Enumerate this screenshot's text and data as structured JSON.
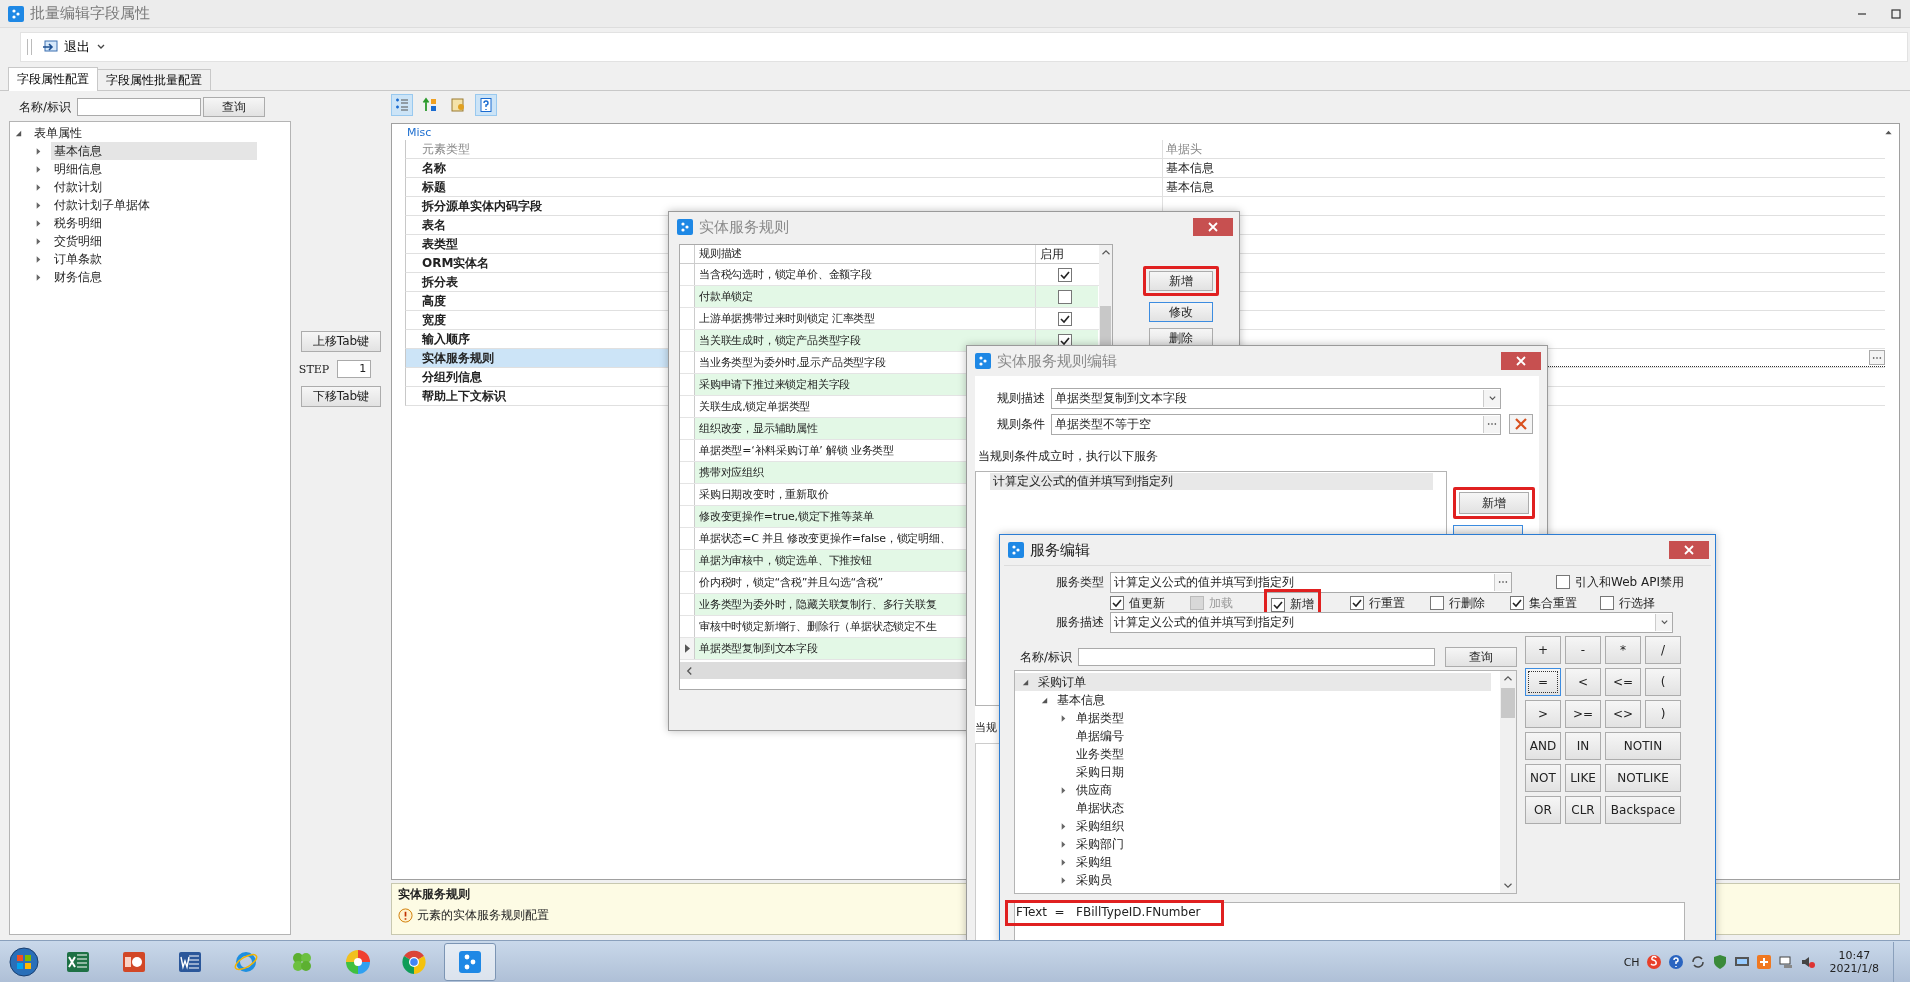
{
  "window": {
    "title": "批量编辑字段属性"
  },
  "toolbar": {
    "exit_label": "退出"
  },
  "tabs": [
    {
      "label": "字段属性配置",
      "selected": true
    },
    {
      "label": "字段属性批量配置",
      "selected": false
    }
  ],
  "left_search": {
    "label": "名称/标识",
    "button": "查询"
  },
  "field_tree": [
    {
      "label": "表单属性",
      "expanded": true,
      "selected": false,
      "children": [
        {
          "label": "基本信息",
          "expanded": false,
          "selected": true
        },
        {
          "label": "明细信息",
          "expanded": false,
          "selected": false
        },
        {
          "label": "付款计划",
          "expanded": false,
          "selected": false
        },
        {
          "label": "付款计划子单据体",
          "expanded": false,
          "selected": false
        },
        {
          "label": "税务明细",
          "expanded": false,
          "selected": false
        },
        {
          "label": "交货明细",
          "expanded": false,
          "selected": false
        },
        {
          "label": "订单条款",
          "expanded": false,
          "selected": false
        },
        {
          "label": "财务信息",
          "expanded": false,
          "selected": false
        }
      ]
    }
  ],
  "tab_order": {
    "up_button": "上移Tab键",
    "step_label": "STEP",
    "step_value": "1",
    "down_button": "下移Tab键"
  },
  "property_grid": {
    "tools": [
      {
        "selected": true
      },
      {
        "selected": false
      },
      {
        "selected": false
      },
      {
        "selected": true
      }
    ],
    "category": "Misc",
    "expanded": true,
    "rows": [
      {
        "name": "元素类型",
        "value": "单据头",
        "readonly": true,
        "selected": false
      },
      {
        "name": "名称",
        "value": "基本信息",
        "readonly": false,
        "selected": false
      },
      {
        "name": "标题",
        "value": "基本信息",
        "readonly": false,
        "selected": false
      },
      {
        "name": "拆分源单实体内码字段",
        "readonly": false,
        "selected": false
      },
      {
        "name": "表名",
        "readonly": false,
        "selected": false
      },
      {
        "name": "表类型",
        "readonly": false,
        "selected": false
      },
      {
        "name": "ORM实体名",
        "readonly": false,
        "selected": false
      },
      {
        "name": "拆分表",
        "readonly": false,
        "selected": false
      },
      {
        "name": "高度",
        "readonly": false,
        "selected": false
      },
      {
        "name": "宽度",
        "readonly": false,
        "selected": false
      },
      {
        "name": "输入顺序",
        "readonly": false,
        "selected": false
      },
      {
        "name": "实体服务规则",
        "readonly": false,
        "selected": true
      },
      {
        "name": "分组列信息",
        "readonly": false,
        "selected": false
      },
      {
        "name": "帮助上下文标识",
        "readonly": false,
        "selected": false
      }
    ]
  },
  "help": {
    "title": "实体服务规则",
    "text": "元素的实体服务规则配置"
  },
  "rules_dialog": {
    "title": "实体服务规则",
    "columns": [
      "规则描述",
      "启用"
    ],
    "rows": [
      {
        "text": "当含税勾选时，锁定单价、金额字段",
        "enabled": true,
        "selected": false
      },
      {
        "text": "付款单锁定",
        "enabled": false,
        "selected": false
      },
      {
        "text": "上游单据携带过来时则锁定 汇率类型",
        "enabled": true,
        "selected": false
      },
      {
        "text": "当关联生成时，锁定产品类型字段",
        "enabled": true,
        "selected": false
      },
      {
        "text": "当业务类型为委外时,显示产品类型字段",
        "selected": false
      },
      {
        "text": "采购申请下推过来锁定相关字段",
        "selected": false
      },
      {
        "text": "关联生成,锁定单据类型",
        "selected": false
      },
      {
        "text": "组织改变，显示辅助属性",
        "selected": false
      },
      {
        "text": "单据类型=‘补料采购订单’ 解锁 业务类型",
        "selected": false
      },
      {
        "text": "携带对应组织",
        "selected": false
      },
      {
        "text": "采购日期改变时，重新取价",
        "selected": false
      },
      {
        "text": "修改变更操作=true,锁定下推等菜单",
        "selected": false
      },
      {
        "text": "单据状态=C 并且 修改变更操作=false，锁定明细、",
        "selected": false
      },
      {
        "text": "单据为审核中，锁定选单、下推按钮",
        "selected": false
      },
      {
        "text": "价内税时，锁定“含税”并且勾选“含税”",
        "selected": false
      },
      {
        "text": "业务类型为委外时，隐藏关联复制行、多行关联复",
        "selected": false
      },
      {
        "text": "审核中时锁定新增行、删除行（单据状态锁定不生",
        "selected": false
      },
      {
        "text": "单据类型复制到文本字段",
        "selected": true
      }
    ],
    "buttons": [
      {
        "label": "新增",
        "highlighted": true,
        "focused": false
      },
      {
        "label": "修改",
        "highlighted": false,
        "focused": true
      },
      {
        "label": "删除",
        "highlighted": false,
        "focused": false
      }
    ]
  },
  "rule_editor": {
    "title": "实体服务规则编辑",
    "description_label": "规则描述",
    "description": "单据类型复制到文本字段",
    "condition_label": "规则条件",
    "condition": "单据类型不等于空",
    "services_heading": "当规则条件成立时，执行以下服务",
    "services": [
      {
        "label": "计算定义公式的值并填写到指定列",
        "selected": true
      }
    ],
    "add_button": {
      "label": "新增",
      "highlighted": true
    },
    "lower_label": "当规"
  },
  "service_editor": {
    "title": "服务编辑",
    "type_label": "服务类型",
    "type": "计算定义公式的值并填写到指定列",
    "webapi": {
      "label": "引入和Web API禁用",
      "checked": false
    },
    "options": [
      {
        "label": "值更新",
        "checked": true,
        "disabled": false,
        "highlighted": false
      },
      {
        "label": "加载",
        "checked": false,
        "disabled": true,
        "highlighted": false
      },
      {
        "label": "新增",
        "checked": true,
        "disabled": false,
        "highlighted": true
      },
      {
        "label": "行重置",
        "checked": true,
        "disabled": false,
        "highlighted": false
      },
      {
        "label": "行删除",
        "checked": false,
        "disabled": false,
        "highlighted": false
      },
      {
        "label": "集合重置",
        "checked": true,
        "disabled": false,
        "highlighted": false
      },
      {
        "label": "行选择",
        "checked": false,
        "disabled": false,
        "highlighted": false
      }
    ],
    "desc_label": "服务描述",
    "desc": "计算定义公式的值并填写到指定列",
    "search_label": "名称/标识",
    "search_button": "查询",
    "tree": [
      {
        "label": "采购订单",
        "expanded": true,
        "selected": true,
        "children": [
          {
            "label": "基本信息",
            "expanded": true,
            "selected": false,
            "children": [
              {
                "label": "单据类型",
                "expanded": false,
                "selected": false
              },
              {
                "label": "单据编号",
                "selected": false
              },
              {
                "label": "业务类型",
                "selected": false
              },
              {
                "label": "采购日期",
                "selected": false
              },
              {
                "label": "供应商",
                "expanded": false,
                "selected": false
              },
              {
                "label": "单据状态",
                "selected": false
              },
              {
                "label": "采购组织",
                "expanded": false,
                "selected": false
              },
              {
                "label": "采购部门",
                "expanded": false,
                "selected": false
              },
              {
                "label": "采购组",
                "expanded": false,
                "selected": false
              },
              {
                "label": "采购员",
                "expanded": false,
                "selected": false
              }
            ]
          }
        ]
      }
    ],
    "operators": [
      [
        {
          "label": "+",
          "focused": false
        },
        {
          "label": "-",
          "focused": false
        },
        {
          "label": "*",
          "focused": false
        },
        {
          "label": "/",
          "focused": false
        }
      ],
      [
        {
          "label": "=",
          "focused": true
        },
        {
          "label": "<",
          "focused": false
        },
        {
          "label": "<=",
          "focused": false
        },
        {
          "label": "(",
          "focused": false
        }
      ],
      [
        {
          "label": ">",
          "focused": false
        },
        {
          "label": ">=",
          "focused": false
        },
        {
          "label": "<>",
          "focused": false
        },
        {
          "label": ")",
          "focused": false
        }
      ],
      [
        {
          "label": "AND",
          "focused": false
        },
        {
          "label": "IN",
          "focused": false
        },
        {
          "label": "NOTIN",
          "focused": false
        }
      ],
      [
        {
          "label": "NOT",
          "focused": false
        },
        {
          "label": "LIKE",
          "focused": false
        },
        {
          "label": "NOTLIKE",
          "focused": false
        }
      ],
      [
        {
          "label": "OR",
          "focused": false
        },
        {
          "label": "CLR",
          "focused": false
        },
        {
          "label": "Backspace",
          "focused": false
        }
      ]
    ],
    "formula": "FText  =   FBillTypeID.FNumber",
    "formula_highlighted": true
  },
  "taskbar": {
    "apps": [
      {
        "selected": false
      },
      {
        "selected": false
      },
      {
        "selected": false
      },
      {
        "selected": false
      },
      {
        "selected": false
      },
      {
        "selected": false
      },
      {
        "selected": false
      },
      {
        "selected": true
      }
    ],
    "lang": "CH",
    "time": "10:47",
    "date": "2021/1/8"
  }
}
